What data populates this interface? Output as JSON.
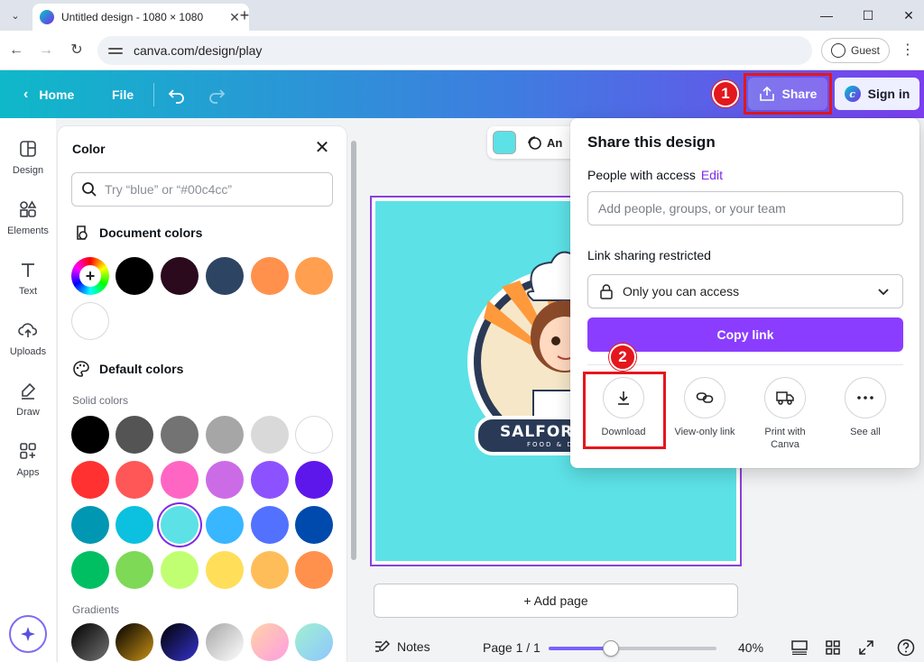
{
  "browser": {
    "tab_title": "Untitled design - 1080 × 1080",
    "url": "canva.com/design/play",
    "guest_label": "Guest"
  },
  "header": {
    "home_label": "Home",
    "file_label": "File",
    "share_label": "Share",
    "signin_label": "Sign in",
    "step1": "1"
  },
  "toolbar_chip": {
    "label": "Animate"
  },
  "left_rail": {
    "items": [
      {
        "label": "Design",
        "icon": "design-icon"
      },
      {
        "label": "Elements",
        "icon": "elements-icon"
      },
      {
        "label": "Text",
        "icon": "text-icon"
      },
      {
        "label": "Uploads",
        "icon": "uploads-icon"
      },
      {
        "label": "Draw",
        "icon": "draw-icon"
      },
      {
        "label": "Apps",
        "icon": "apps-icon"
      }
    ]
  },
  "color_panel": {
    "title": "Color",
    "search_placeholder": "Try “blue” or “#00c4cc”",
    "document_colors_title": "Document colors",
    "document_colors": [
      "#000000",
      "#2a0a1c",
      "#2e4463",
      "#ff914d",
      "#ff9f4f",
      "#ffffff"
    ],
    "default_colors_title": "Default colors",
    "solid_colors_title": "Solid colors",
    "solid_colors": [
      [
        "#000000",
        "#545454",
        "#737373",
        "#a6a6a6",
        "#d9d9d9",
        "#ffffff"
      ],
      [
        "#ff3131",
        "#ff5757",
        "#ff66c4",
        "#cb6ce6",
        "#8c52ff",
        "#5e17eb"
      ],
      [
        "#0097b2",
        "#0cc0df",
        "#5ce1e6",
        "#38b6ff",
        "#5271ff",
        "#004aad"
      ],
      [
        "#00bf63",
        "#7ed957",
        "#c1ff72",
        "#ffde59",
        "#ffbd59",
        "#ff914d"
      ]
    ],
    "selected_color": "#5ce1e6",
    "gradients_title": "Gradients"
  },
  "design": {
    "background": "#5ce1e6",
    "logo_text": "SALFORD",
    "logo_subtext": "FOOD & D"
  },
  "add_page_label": "+ Add page",
  "bottom_bar": {
    "notes_label": "Notes",
    "page_label": "Page 1 / 1",
    "zoom_label": "40%",
    "zoom_fraction": 0.37
  },
  "share_popup": {
    "title": "Share this design",
    "people_label": "People with access",
    "edit_label": "Edit",
    "add_people_placeholder": "Add people, groups, or your team",
    "link_sharing_label": "Link sharing restricted",
    "access_value": "Only you can access",
    "copy_link_label": "Copy link",
    "step2": "2",
    "actions": [
      {
        "label": "Download",
        "icon": "download-icon"
      },
      {
        "label": "View-only link",
        "icon": "link-icon"
      },
      {
        "label": "Print with Canva",
        "icon": "truck-icon"
      },
      {
        "label": "See all",
        "icon": "more-icon"
      }
    ]
  }
}
